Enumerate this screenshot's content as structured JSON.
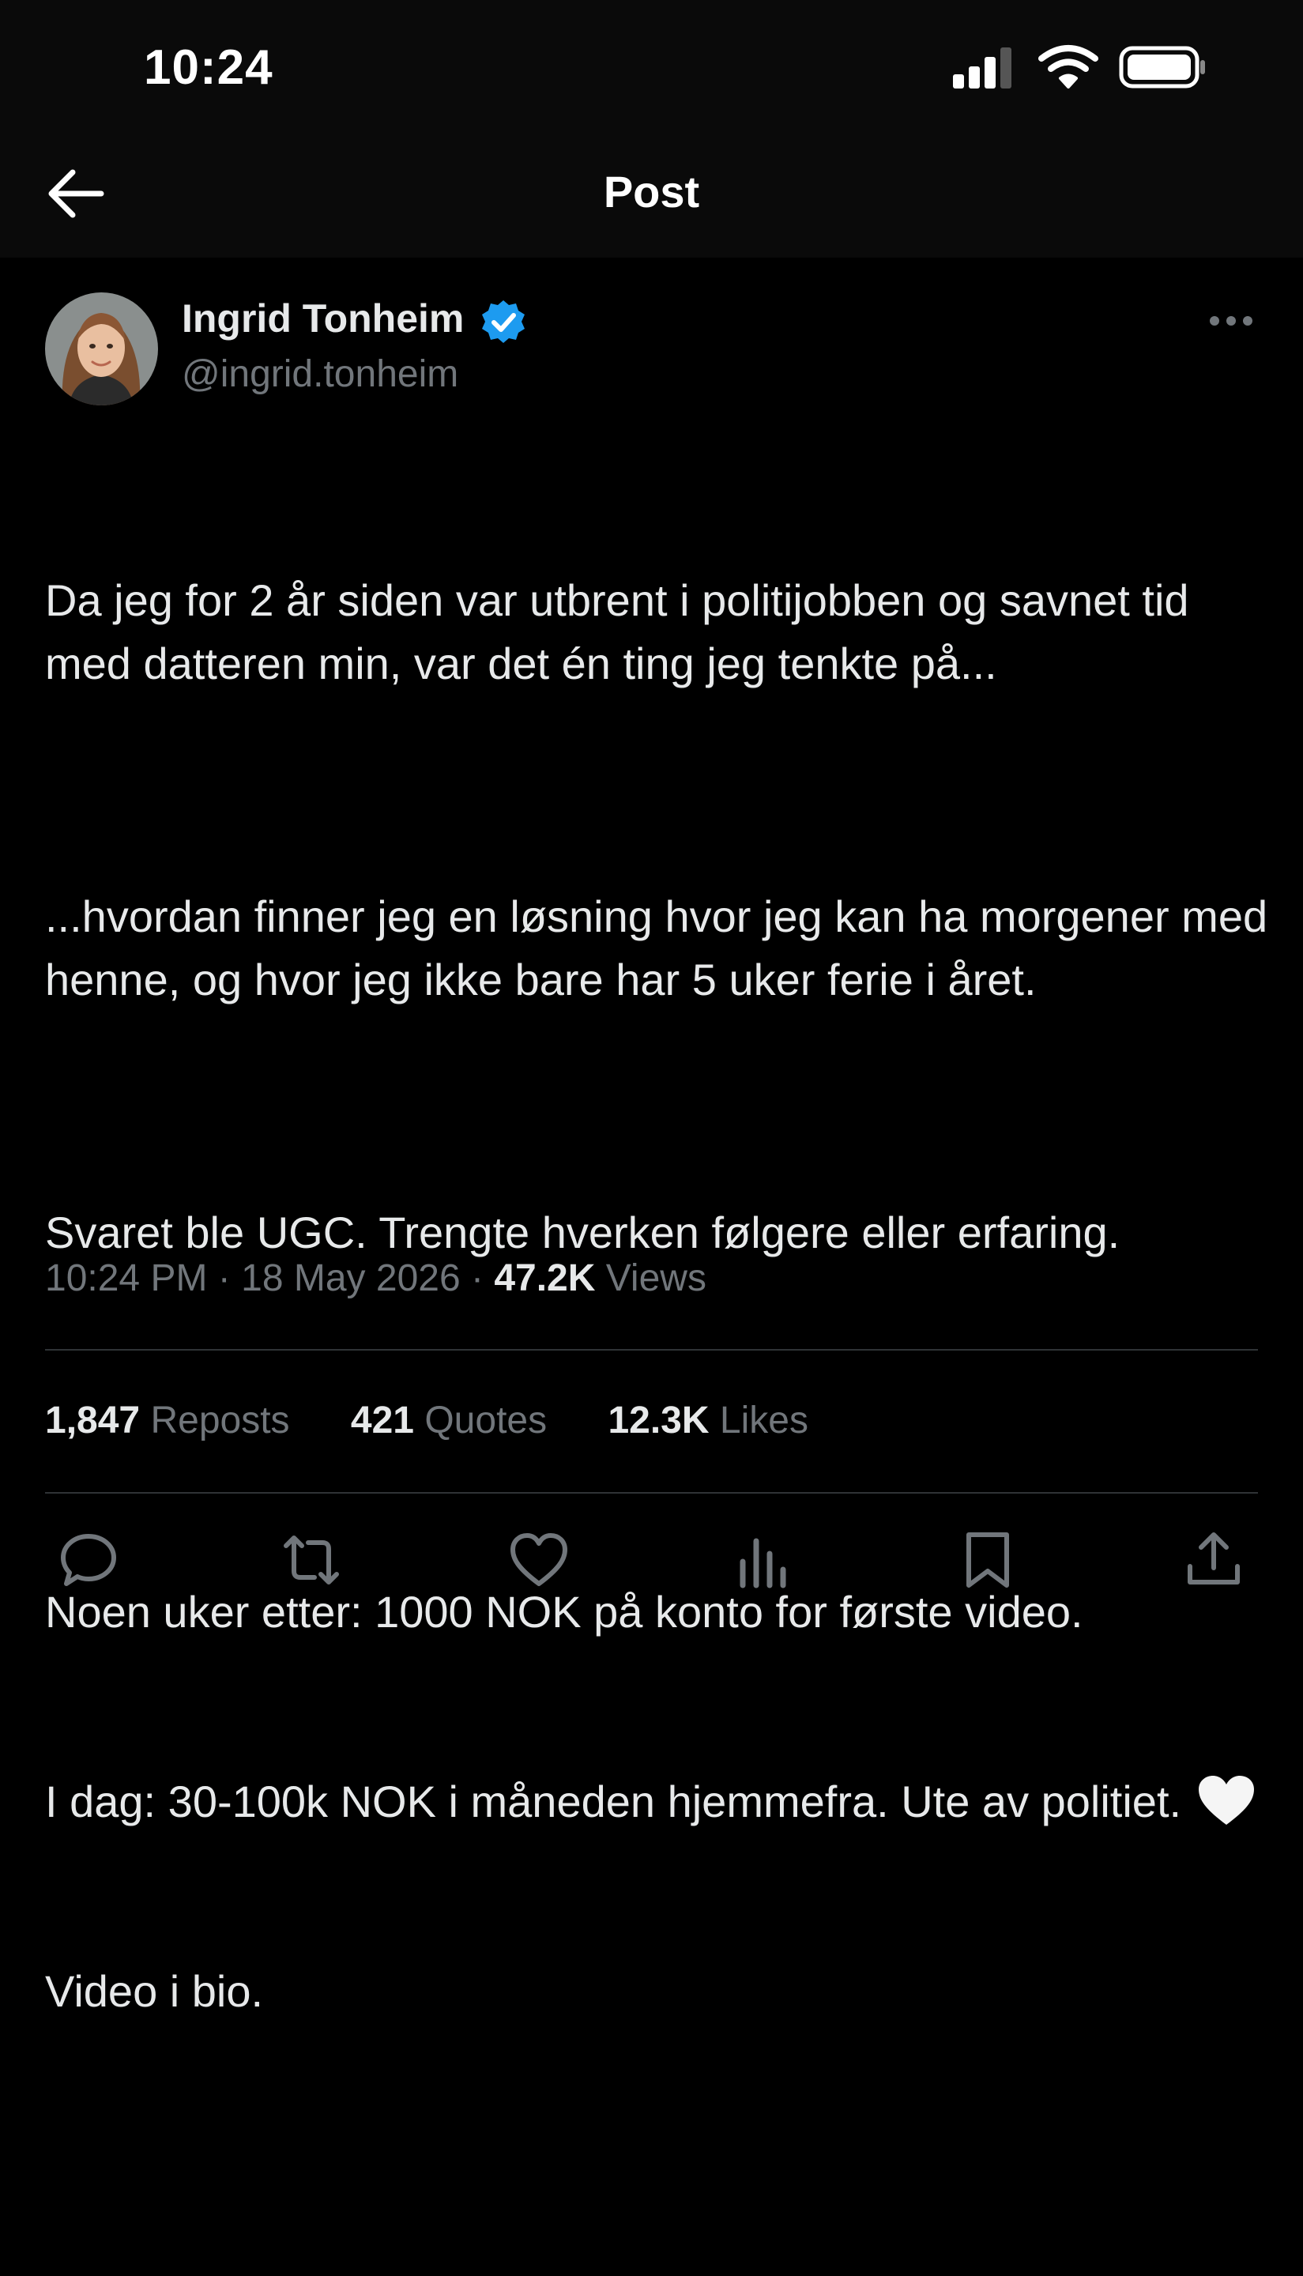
{
  "status_bar": {
    "time": "10:24",
    "icons": [
      "signal-icon",
      "wifi-icon",
      "battery-icon"
    ]
  },
  "header": {
    "back_icon": "arrow-left-icon",
    "title": "Post"
  },
  "post": {
    "author": {
      "name": "Ingrid Tonheim",
      "handle": "@ingrid.tonheim",
      "verified": true,
      "avatar_icon": "avatar-photo"
    },
    "paragraphs": [
      "Da jeg for 2 år siden var utbrent i politijobben og savnet tid med datteren min, var det én ting jeg tenkte på...",
      "...hvordan finner jeg en løsning hvor jeg kan ha morgener med henne, og hvor jeg ikke bare har 5 uker ferie i året.",
      "Svaret ble UGC. Trengte hverken følgere eller erfaring."
    ],
    "last_paragraph": {
      "line1": "Noen uker etter: 1000 NOK på konto for første video.",
      "line2": "I dag: 30-100k NOK i måneden hjemmefra. Ute av politiet.",
      "emoji": "white-heart-emoji",
      "line3": "Video i bio."
    },
    "meta": {
      "time": "10:24 PM",
      "date": "18 May 2026",
      "separator": "·",
      "views_count": "47.2K",
      "views_label": "Views"
    },
    "stats": {
      "reposts_count": "1,847",
      "reposts_label": "Reposts",
      "quotes_count": "421",
      "quotes_label": "Quotes",
      "likes_count": "12.3K",
      "likes_label": "Likes"
    },
    "actions": [
      "reply-icon",
      "repost-icon",
      "like-icon",
      "views-icon",
      "bookmark-icon",
      "share-icon"
    ]
  },
  "colors": {
    "background": "#000000",
    "chrome": "#0a0a0a",
    "text_primary": "#e7e9ea",
    "text_secondary": "#71767b",
    "divider": "#2f3336",
    "verified_blue": "#1d9bf0"
  }
}
